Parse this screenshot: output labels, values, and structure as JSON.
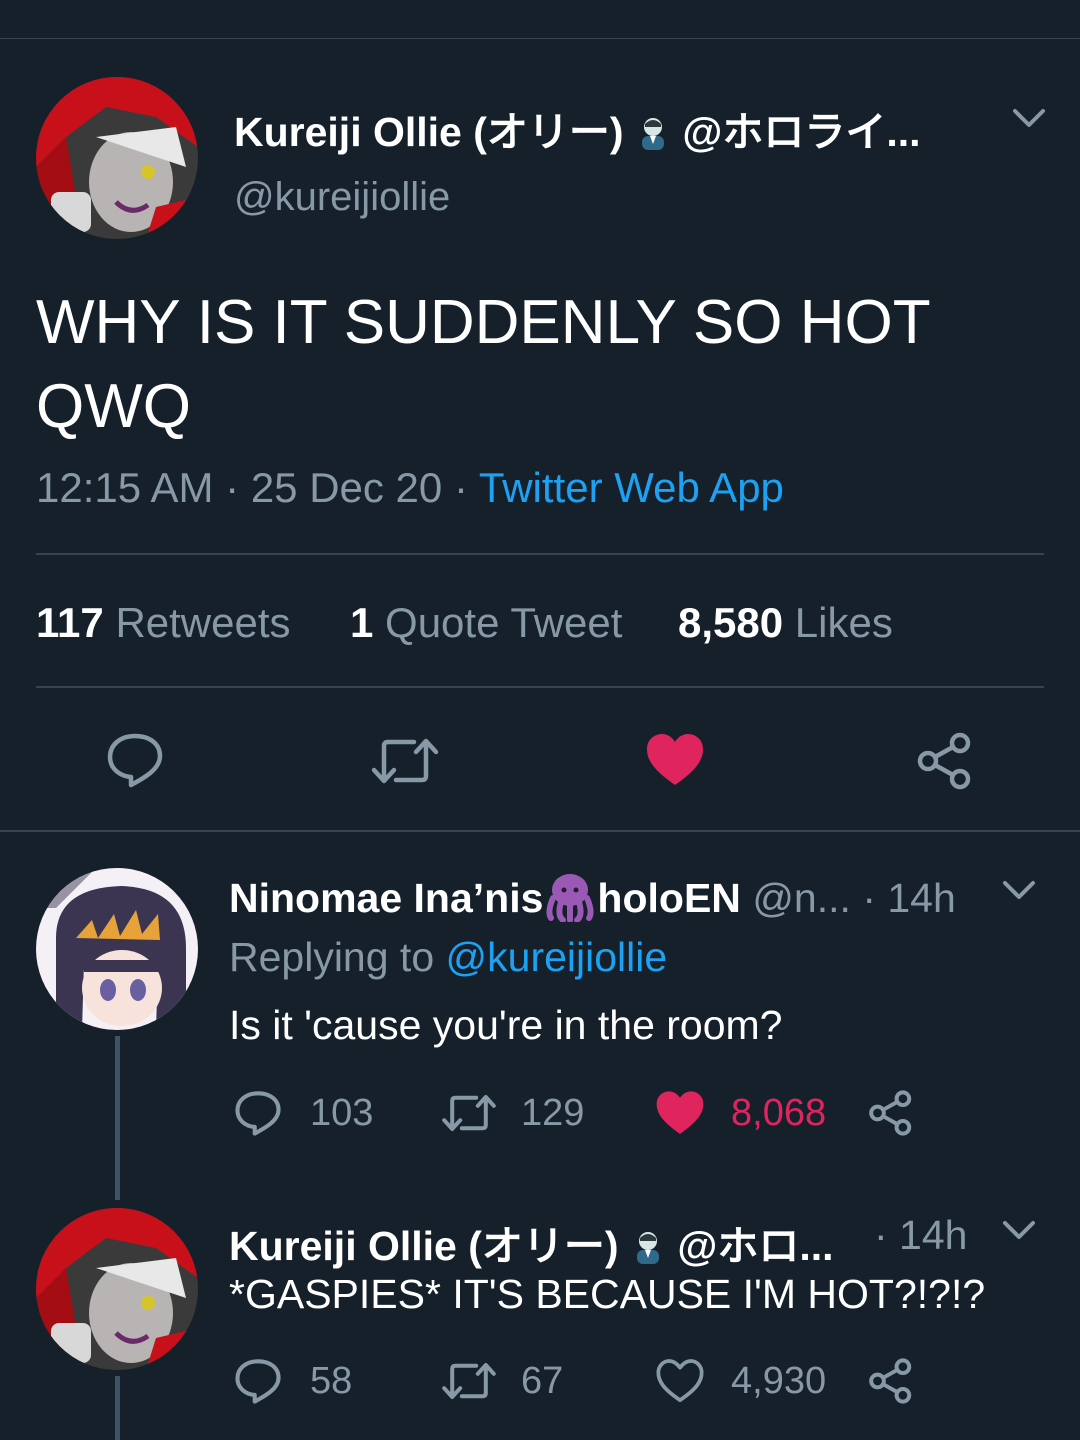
{
  "main_tweet": {
    "display_name": "Kureiji Ollie (オリー)",
    "name_suffix": "@ホロライ...",
    "handle": "@kureijiollie",
    "text_line1": "WHY IS IT SUDDENLY SO HOT",
    "text_line2": "QWQ",
    "time": "12:15 AM",
    "sep1": "·",
    "date": "25 Dec 20",
    "sep2": "·",
    "client": "Twitter Web App",
    "stats": {
      "retweets_count": "117",
      "retweets_label": "Retweets",
      "quotes_count": "1",
      "quotes_label": "Quote Tweet",
      "likes_count": "8,580",
      "likes_label": "Likes"
    }
  },
  "reply1": {
    "name_part1": "Ninomae Ina’nis",
    "name_part2": "holoEN",
    "handle": "@n...",
    "time": "· 14h",
    "replying_label": "Replying to",
    "replying_handle": "@kureijiollie",
    "text": "Is it 'cause you're in the room?",
    "replies": "103",
    "retweets": "129",
    "likes": "8,068"
  },
  "reply2": {
    "display_name": "Kureiji Ollie (オリー)",
    "name_suffix": "@ホロ...",
    "time": "· 14h",
    "text": "*GASPIES* IT'S BECAUSE I'M HOT?!?!?",
    "replies": "58",
    "retweets": "67",
    "likes": "4,930"
  },
  "colors": {
    "background": "#15202b",
    "muted": "#8899a6",
    "link": "#1da1f2",
    "like": "#e0245e",
    "divider": "#38444d"
  },
  "icons": [
    "chevron-down-icon",
    "reply-icon",
    "retweet-icon",
    "heart-filled-icon",
    "heart-outline-icon",
    "share-icon",
    "zombie-emoji-icon",
    "octopus-emoji-icon"
  ]
}
